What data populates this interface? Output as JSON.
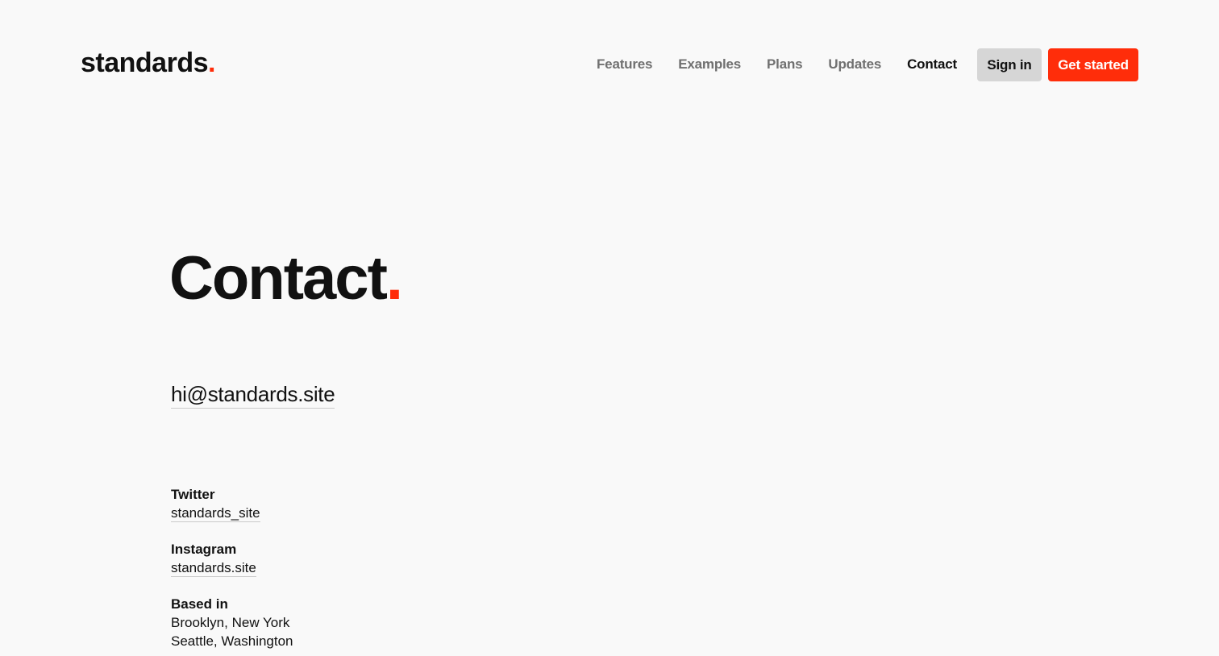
{
  "brand": {
    "name": "standards",
    "accent_dot": ".",
    "accent_color": "#ff2d0a"
  },
  "nav": {
    "items": [
      {
        "label": "Features"
      },
      {
        "label": "Examples"
      },
      {
        "label": "Plans"
      },
      {
        "label": "Updates"
      },
      {
        "label": "Contact",
        "active": true
      }
    ]
  },
  "actions": {
    "sign_in": "Sign in",
    "get_started": "Get started"
  },
  "main": {
    "title": "Contact",
    "title_dot": ".",
    "email": "hi@standards.site",
    "twitter": {
      "label": "Twitter",
      "handle": "standards_site"
    },
    "instagram": {
      "label": "Instagram",
      "handle": "standards.site"
    },
    "based_in": {
      "label": "Based in",
      "locations": [
        "Brooklyn, New York",
        "Seattle, Washington"
      ]
    }
  }
}
